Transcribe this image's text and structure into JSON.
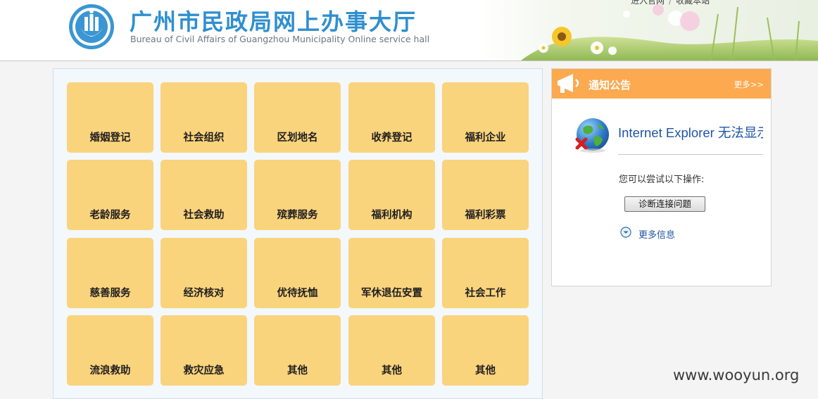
{
  "header": {
    "title": "广州市民政局网上办事大厅",
    "subtitle": "Bureau of Civil Affairs of Guangzhou Municipality Online service hall",
    "links": [
      "进入官网",
      "收藏本站"
    ],
    "link_separator": "/"
  },
  "services": [
    "婚姻登记",
    "社会组织",
    "区划地名",
    "收养登记",
    "福利企业",
    "老龄服务",
    "社会救助",
    "殡葬服务",
    "福利机构",
    "福利彩票",
    "慈善服务",
    "经济核对",
    "优待抚恤",
    "军休退伍安置",
    "社会工作",
    "流浪救助",
    "救灾应急",
    "其他",
    "其他",
    "其他"
  ],
  "notice": {
    "title": "通知公告",
    "more": "更多>>",
    "ie_error": {
      "title": "Internet Explorer 无法显示该网页",
      "hint": "您可以尝试以下操作:",
      "diagnose_button": "诊断连接问题",
      "more_info": "更多信息"
    }
  },
  "watermark": "www.wooyun.org",
  "colors": {
    "title_blue": "#2f8fcf",
    "tile_yellow": "#fad37d",
    "notice_orange": "#fca94f",
    "link_blue": "#1f55a6"
  }
}
